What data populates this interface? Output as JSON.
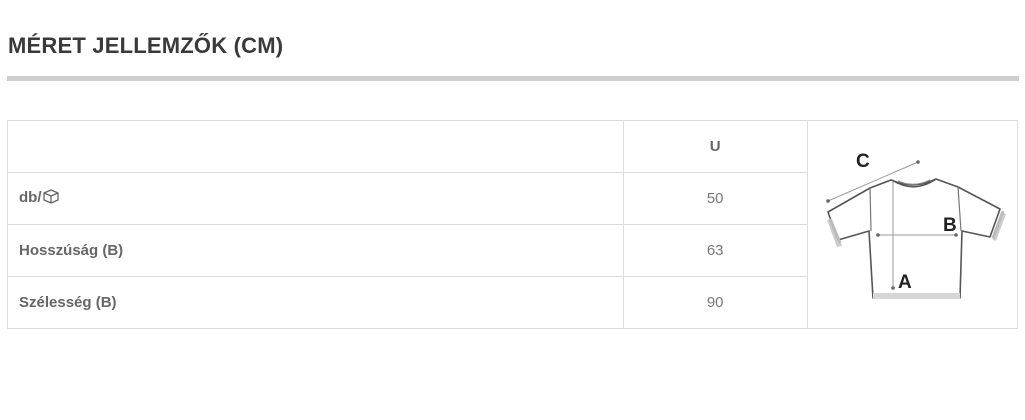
{
  "title": "MÉRET JELLEMZŐK (CM)",
  "table": {
    "header": {
      "label": "",
      "size": "U"
    },
    "rows": [
      {
        "label": "db/",
        "icon": "box-icon",
        "value": "50"
      },
      {
        "label": "Hosszúság (B)",
        "value": "63"
      },
      {
        "label": "Szélesség (B)",
        "value": "90"
      }
    ]
  },
  "diagram": {
    "labels": {
      "a": "A",
      "b": "B",
      "c": "C"
    }
  }
}
